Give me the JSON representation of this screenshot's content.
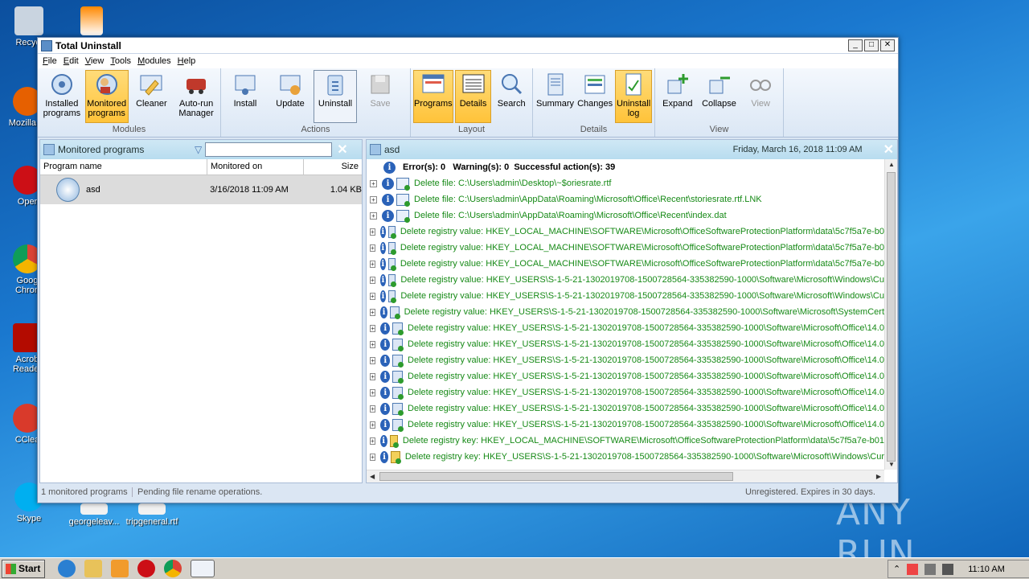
{
  "desktop": {
    "icons": [
      {
        "label": "Recycl",
        "color": "#c9d4e0"
      },
      {
        "label": "Mozilla Fi",
        "color": "#e66000"
      },
      {
        "label": "Oper",
        "color": "#cc0f16"
      },
      {
        "label": "Goog Chron",
        "color": "#2fa04a"
      },
      {
        "label": "Acrob Reader",
        "color": "#b30b00"
      },
      {
        "label": "CClea",
        "color": "#d93a2b"
      },
      {
        "label": "Skype",
        "color": "#00aff0"
      }
    ],
    "files": [
      "georgeleav...",
      "tripgeneral.rtf"
    ],
    "watermark": "ANY RUN"
  },
  "window": {
    "title": "Total Uninstall",
    "menu": [
      "File",
      "Edit",
      "View",
      "Tools",
      "Modules",
      "Help"
    ]
  },
  "ribbon": {
    "modules": {
      "label": "Modules",
      "buttons": [
        {
          "label": "Installed programs",
          "active": false
        },
        {
          "label": "Monitored programs",
          "active": true
        },
        {
          "label": "Cleaner",
          "active": false
        },
        {
          "label": "Auto-run Manager",
          "active": false
        }
      ]
    },
    "actions": {
      "label": "Actions",
      "buttons": [
        {
          "label": "Install"
        },
        {
          "label": "Update"
        },
        {
          "label": "Uninstall"
        },
        {
          "label": "Save"
        }
      ]
    },
    "layout": {
      "label": "Layout",
      "buttons": [
        {
          "label": "Programs",
          "active": true
        },
        {
          "label": "Details",
          "active": true
        },
        {
          "label": "Search",
          "active": false
        }
      ]
    },
    "details": {
      "label": "Details",
      "buttons": [
        {
          "label": "Summary",
          "active": false
        },
        {
          "label": "Changes",
          "active": false
        },
        {
          "label": "Uninstall log",
          "active": true
        }
      ]
    },
    "view": {
      "label": "View",
      "buttons": [
        {
          "label": "Expand"
        },
        {
          "label": "Collapse"
        },
        {
          "label": "View"
        }
      ]
    }
  },
  "left_pane": {
    "title": "Monitored programs",
    "filter_value": "",
    "columns": [
      "Program name",
      "Monitored on",
      "Size"
    ],
    "rows": [
      {
        "name": "asd",
        "date": "3/16/2018 11:09 AM",
        "size": "1.04 KB"
      }
    ]
  },
  "right_pane": {
    "title": "asd",
    "date": "Friday, March 16, 2018 11:09 AM",
    "summary": "Error(s): 0   Warning(s): 0  Successful action(s): 39",
    "entries": [
      {
        "type": "file",
        "text": "Delete file: C:\\Users\\admin\\Desktop\\~$oriesrate.rtf"
      },
      {
        "type": "file",
        "text": "Delete file: C:\\Users\\admin\\AppData\\Roaming\\Microsoft\\Office\\Recent\\storiesrate.rtf.LNK"
      },
      {
        "type": "file",
        "text": "Delete file: C:\\Users\\admin\\AppData\\Roaming\\Microsoft\\Office\\Recent\\index.dat"
      },
      {
        "type": "reg",
        "text": "Delete registry value: HKEY_LOCAL_MACHINE\\SOFTWARE\\Microsoft\\OfficeSoftwareProtectionPlatform\\data\\5c7f5a7e-b0"
      },
      {
        "type": "reg",
        "text": "Delete registry value: HKEY_LOCAL_MACHINE\\SOFTWARE\\Microsoft\\OfficeSoftwareProtectionPlatform\\data\\5c7f5a7e-b0"
      },
      {
        "type": "reg",
        "text": "Delete registry value: HKEY_LOCAL_MACHINE\\SOFTWARE\\Microsoft\\OfficeSoftwareProtectionPlatform\\data\\5c7f5a7e-b0"
      },
      {
        "type": "reg",
        "text": "Delete registry value: HKEY_USERS\\S-1-5-21-1302019708-1500728564-335382590-1000\\Software\\Microsoft\\Windows\\Cu"
      },
      {
        "type": "reg",
        "text": "Delete registry value: HKEY_USERS\\S-1-5-21-1302019708-1500728564-335382590-1000\\Software\\Microsoft\\Windows\\Cu"
      },
      {
        "type": "reg",
        "text": "Delete registry value: HKEY_USERS\\S-1-5-21-1302019708-1500728564-335382590-1000\\Software\\Microsoft\\SystemCert"
      },
      {
        "type": "reg",
        "text": "Delete registry value: HKEY_USERS\\S-1-5-21-1302019708-1500728564-335382590-1000\\Software\\Microsoft\\Office\\14.0"
      },
      {
        "type": "reg",
        "text": "Delete registry value: HKEY_USERS\\S-1-5-21-1302019708-1500728564-335382590-1000\\Software\\Microsoft\\Office\\14.0"
      },
      {
        "type": "reg",
        "text": "Delete registry value: HKEY_USERS\\S-1-5-21-1302019708-1500728564-335382590-1000\\Software\\Microsoft\\Office\\14.0"
      },
      {
        "type": "reg",
        "text": "Delete registry value: HKEY_USERS\\S-1-5-21-1302019708-1500728564-335382590-1000\\Software\\Microsoft\\Office\\14.0"
      },
      {
        "type": "reg",
        "text": "Delete registry value: HKEY_USERS\\S-1-5-21-1302019708-1500728564-335382590-1000\\Software\\Microsoft\\Office\\14.0"
      },
      {
        "type": "reg",
        "text": "Delete registry value: HKEY_USERS\\S-1-5-21-1302019708-1500728564-335382590-1000\\Software\\Microsoft\\Office\\14.0"
      },
      {
        "type": "reg",
        "text": "Delete registry value: HKEY_USERS\\S-1-5-21-1302019708-1500728564-335382590-1000\\Software\\Microsoft\\Office\\14.0"
      },
      {
        "type": "key",
        "text": "Delete registry key: HKEY_LOCAL_MACHINE\\SOFTWARE\\Microsoft\\OfficeSoftwareProtectionPlatform\\data\\5c7f5a7e-b01"
      },
      {
        "type": "key",
        "text": "Delete registry key: HKEY_USERS\\S-1-5-21-1302019708-1500728564-335382590-1000\\Software\\Microsoft\\Windows\\Cur"
      }
    ]
  },
  "status": {
    "count": "1 monitored programs",
    "pending": "Pending file rename operations.",
    "license": "Unregistered. Expires in 30 days."
  },
  "taskbar": {
    "start_label": "Start",
    "clock": "11:10 AM"
  }
}
